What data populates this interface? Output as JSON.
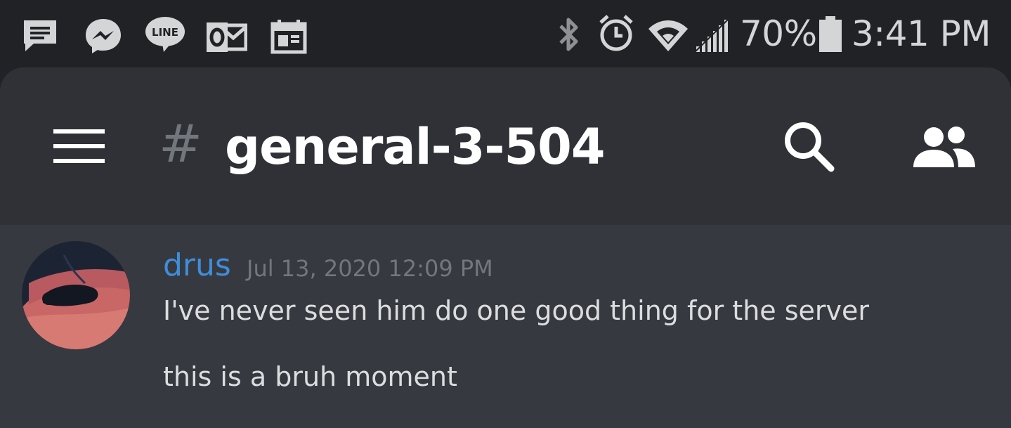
{
  "status_bar": {
    "notification_icons": [
      "message-icon",
      "messenger-icon",
      "line-icon",
      "outlook-icon",
      "calendar-icon"
    ],
    "system_icons": [
      "bluetooth-icon",
      "alarm-icon",
      "wifi-icon",
      "signal-icon",
      "battery-icon"
    ],
    "line_badge": "LINE",
    "battery_percent": "70%",
    "time": "3:41 PM"
  },
  "header": {
    "menu_icon": "hamburger-menu-icon",
    "hash_symbol": "#",
    "channel_name": "general-3-504",
    "search_icon": "search-icon",
    "members_icon": "members-icon"
  },
  "messages": [
    {
      "author": "drus",
      "timestamp": "Jul 13, 2020 12:09 PM",
      "lines": [
        "I've never seen him do one good thing for the server",
        "this is a bruh moment"
      ]
    }
  ],
  "colors": {
    "status_bar_bg": "#202225",
    "header_bg": "#2f3136",
    "chat_bg": "#36393f",
    "author_color": "#3f8edb",
    "timestamp_color": "#72767d",
    "text_color": "#dcddde"
  }
}
